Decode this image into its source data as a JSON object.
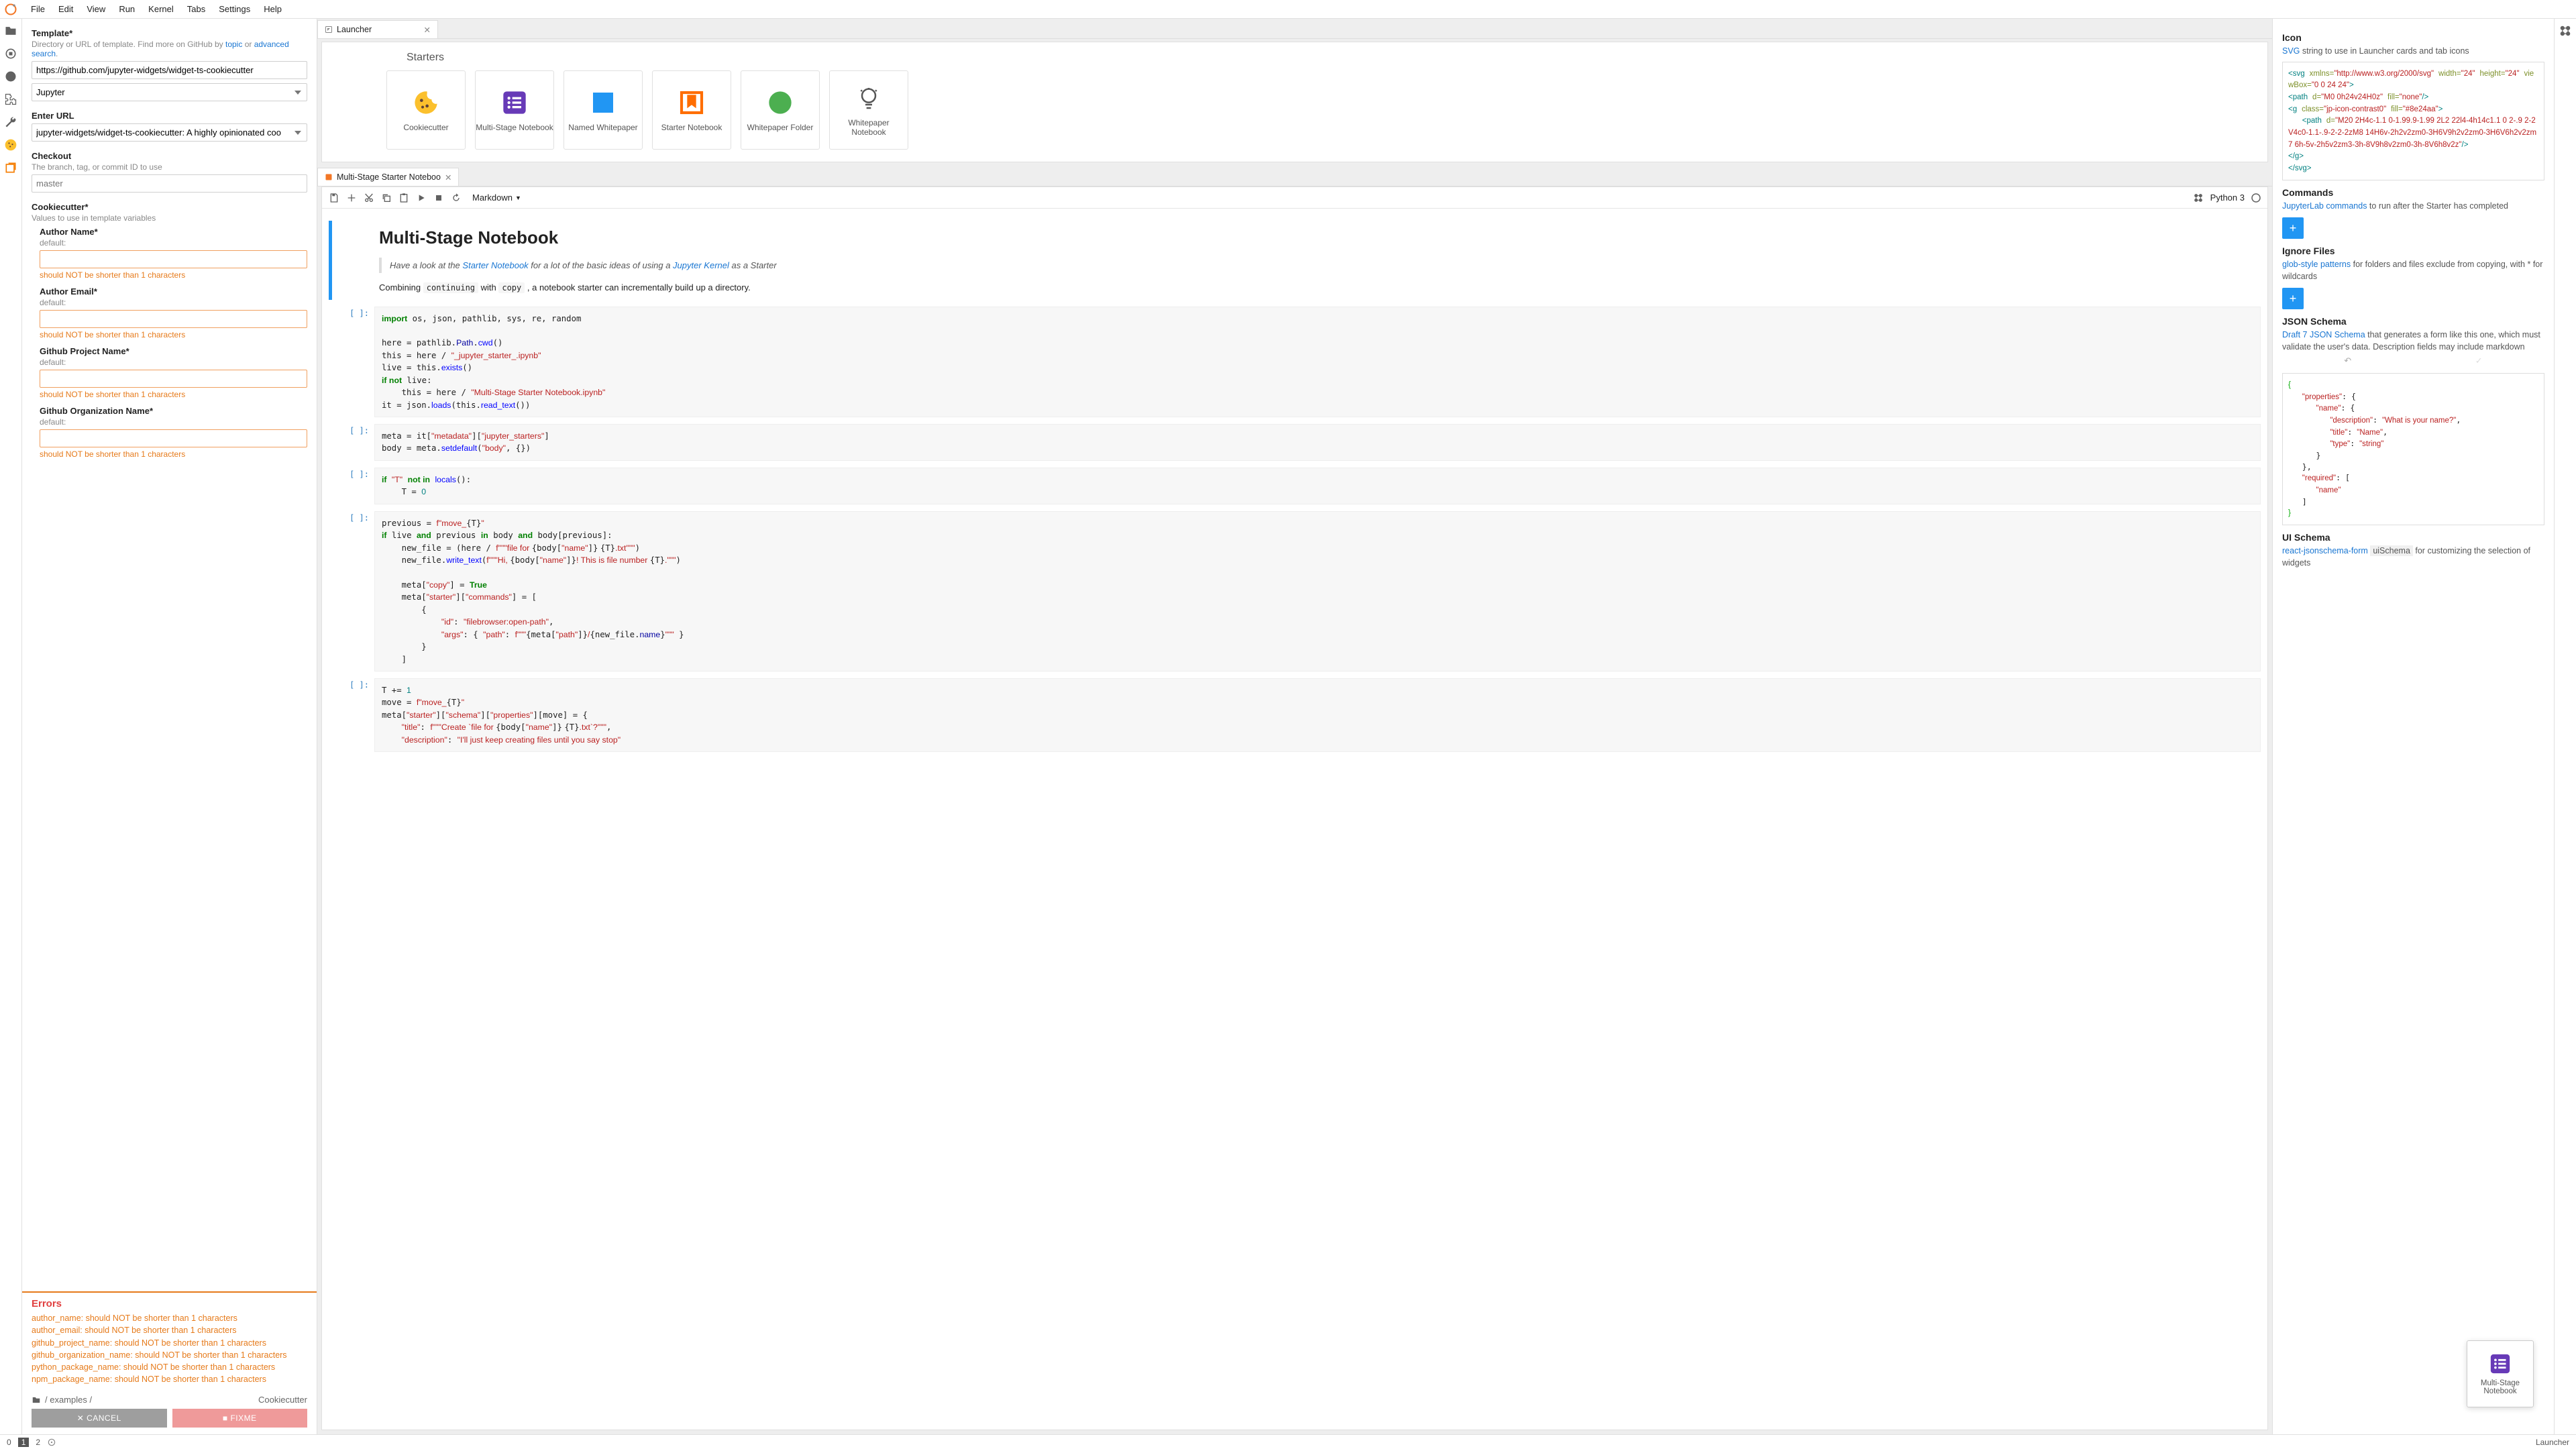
{
  "menu": [
    "File",
    "Edit",
    "View",
    "Run",
    "Kernel",
    "Tabs",
    "Settings",
    "Help"
  ],
  "left": {
    "template": {
      "label": "Template*",
      "help1": "Directory or URL of template. Find more on GitHub by ",
      "topic": "topic",
      "or": " or ",
      "adv": "advanced search",
      "value": "https://github.com/jupyter-widgets/widget-ts-cookiecutter",
      "select": "Jupyter"
    },
    "url": {
      "label": "Enter URL",
      "value": "jupyter-widgets/widget-ts-cookiecutter: A highly opinionated coo"
    },
    "checkout": {
      "label": "Checkout",
      "help": "The branch, tag, or commit ID to use",
      "placeholder": "master"
    },
    "cc": {
      "label": "Cookiecutter*",
      "help": "Values to use in template variables"
    },
    "fields": [
      {
        "label": "Author Name*",
        "def": "default:"
      },
      {
        "label": "Author Email*",
        "def": "default:"
      },
      {
        "label": "Github Project Name*",
        "def": "default:"
      },
      {
        "label": "Github Organization Name*",
        "def": "default:"
      }
    ],
    "errmsg": "should NOT be shorter than 1 characters",
    "errors": {
      "title": "Errors",
      "items": [
        "author_name: should NOT be shorter than 1 characters",
        "author_email: should NOT be shorter than 1 characters",
        "github_project_name: should NOT be shorter than 1 characters",
        "github_organization_name: should NOT be shorter than 1 characters",
        "python_package_name: should NOT be shorter than 1 characters",
        "npm_package_name: should NOT be shorter than 1 characters"
      ]
    },
    "crumb": {
      "a": "/ examples /",
      "r": "Cookiecutter"
    },
    "cancel": "CANCEL",
    "fixme": "FIXME"
  },
  "launcher": {
    "tab": "Launcher",
    "section": "Starters",
    "cards": [
      "Cookiecutter",
      "Multi-Stage Notebook",
      "Named Whitepaper",
      "Starter Notebook",
      "Whitepaper Folder",
      "Whitepaper Notebook"
    ]
  },
  "nb": {
    "tab": "Multi-Stage Starter Noteboo",
    "toolbar": {
      "celltype": "Markdown",
      "kernel": "Python 3"
    },
    "md": {
      "title": "Multi-Stage Notebook",
      "quote1": "Have a look at the ",
      "qlink1": "Starter Notebook",
      "quote2": " for a lot of the basic ideas of using a ",
      "qlink2": "Jupyter Kernel",
      "quote3": " as a Starter",
      "p1a": "Combining ",
      "c1": "continuing",
      "p1b": " with ",
      "c2": "copy",
      "p1c": " , a notebook starter can incrementally build up a directory."
    }
  },
  "right": {
    "icon": {
      "h": "Icon",
      "link": "SVG",
      "txt": " string to use in Launcher cards and tab icons"
    },
    "cmd": {
      "h": "Commands",
      "link": "JupyterLab commands",
      "txt": " to run after the Starter has completed"
    },
    "ign": {
      "h": "Ignore Files",
      "link": "glob-style patterns",
      "txt1": " for folders and files exclude from copying, with ",
      "star": "*",
      "txt2": " for wildcards"
    },
    "jsch": {
      "h": "JSON Schema",
      "link": "Draft 7 JSON Schema",
      "txt": " that generates a form like this one, which must validate the user's data. Description fields may include markdown"
    },
    "uisch": {
      "h": "UI Schema",
      "link": "react-jsonschema-form",
      "code": "uiSchema",
      "txt": " for customizing the selection of widgets"
    },
    "drag": "Multi-Stage Notebook"
  },
  "status": {
    "a": "0",
    "b": "1",
    "c": "2",
    "launcher": "Launcher"
  }
}
